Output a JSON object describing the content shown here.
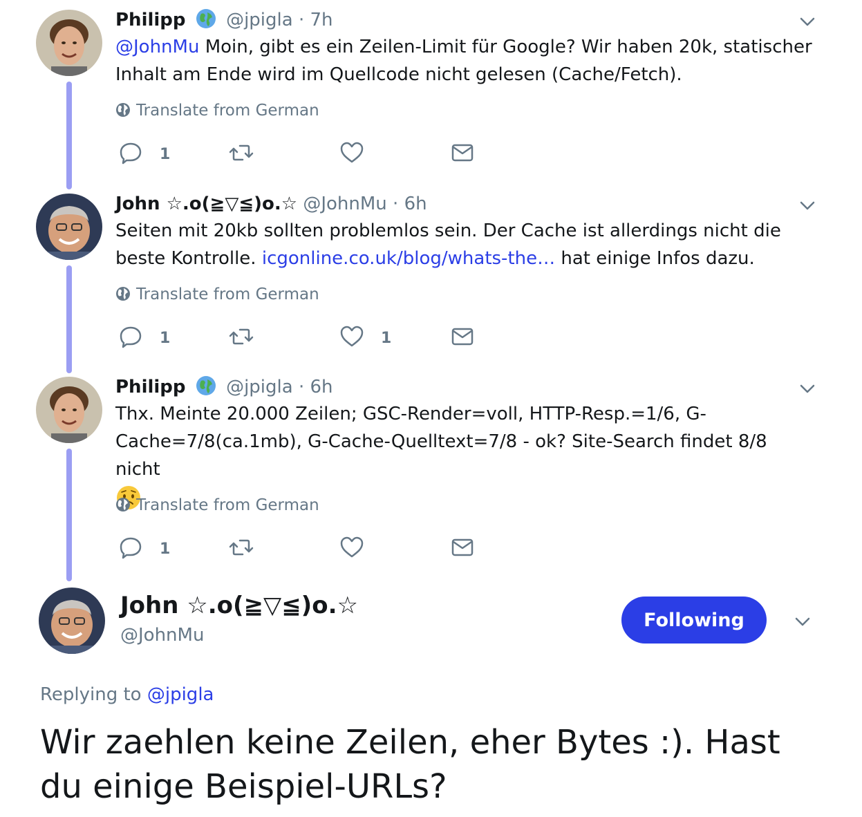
{
  "thread": [
    {
      "name": "Philipp",
      "has_globe_badge": true,
      "handle": "@jpigla",
      "separator": "·",
      "time": "7h",
      "body": [
        {
          "type": "link",
          "text": "@JohnMu"
        },
        {
          "type": "text",
          "text": " Moin, gibt es ein Zeilen-Limit für Google? Wir haben 20k, statischer Inhalt am Ende wird im Quellcode nicht gelesen (Cache/Fetch)."
        }
      ],
      "translate_label": "Translate from German",
      "reply_count": "1",
      "retweet_count": "",
      "like_count": ""
    },
    {
      "name": "John ☆.o(≧▽≦)o.☆",
      "has_globe_badge": false,
      "handle": "@JohnMu",
      "separator": "·",
      "time": "6h",
      "body": [
        {
          "type": "text",
          "text": "Seiten mit 20kb sollten problemlos sein. Der Cache ist allerdings nicht die beste Kontrolle. "
        },
        {
          "type": "link",
          "text": "icgonline.co.uk/blog/whats-the…"
        },
        {
          "type": "text",
          "text": " hat einige Infos dazu."
        }
      ],
      "translate_label": "Translate from German",
      "reply_count": "1",
      "retweet_count": "",
      "like_count": "1"
    },
    {
      "name": "Philipp",
      "has_globe_badge": true,
      "handle": "@jpigla",
      "separator": "·",
      "time": "6h",
      "body": [
        {
          "type": "text",
          "text": "Thx. Meinte 20.000 Zeilen; GSC-Render=voll, HTTP-Resp.=1/6, G-Cache=7/8(ca.1mb), G-Cache-Quelltext=7/8 - ok? Site-Search findet 8/8 nicht"
        }
      ],
      "emoji": "worried-face",
      "translate_label": "Translate from German",
      "reply_count": "1",
      "retweet_count": "",
      "like_count": ""
    }
  ],
  "main_tweet": {
    "name": "John ☆.o(≧▽≦)o.☆",
    "handle": "@JohnMu",
    "follow_label": "Following",
    "replying_prefix": "Replying to",
    "replying_to": "@jpigla",
    "text": "Wir zaehlen keine Zeilen, eher Bytes :). Hast du einige Beispiel-URLs?"
  },
  "colors": {
    "link": "#2b3ee6",
    "thread_line": "#9b9ef3",
    "muted": "#657786",
    "text": "#14171a",
    "button": "#2b3ee6"
  },
  "icons": [
    "reply-icon",
    "retweet-icon",
    "like-icon",
    "direct-message-icon",
    "globe-icon",
    "chevron-down-icon"
  ]
}
